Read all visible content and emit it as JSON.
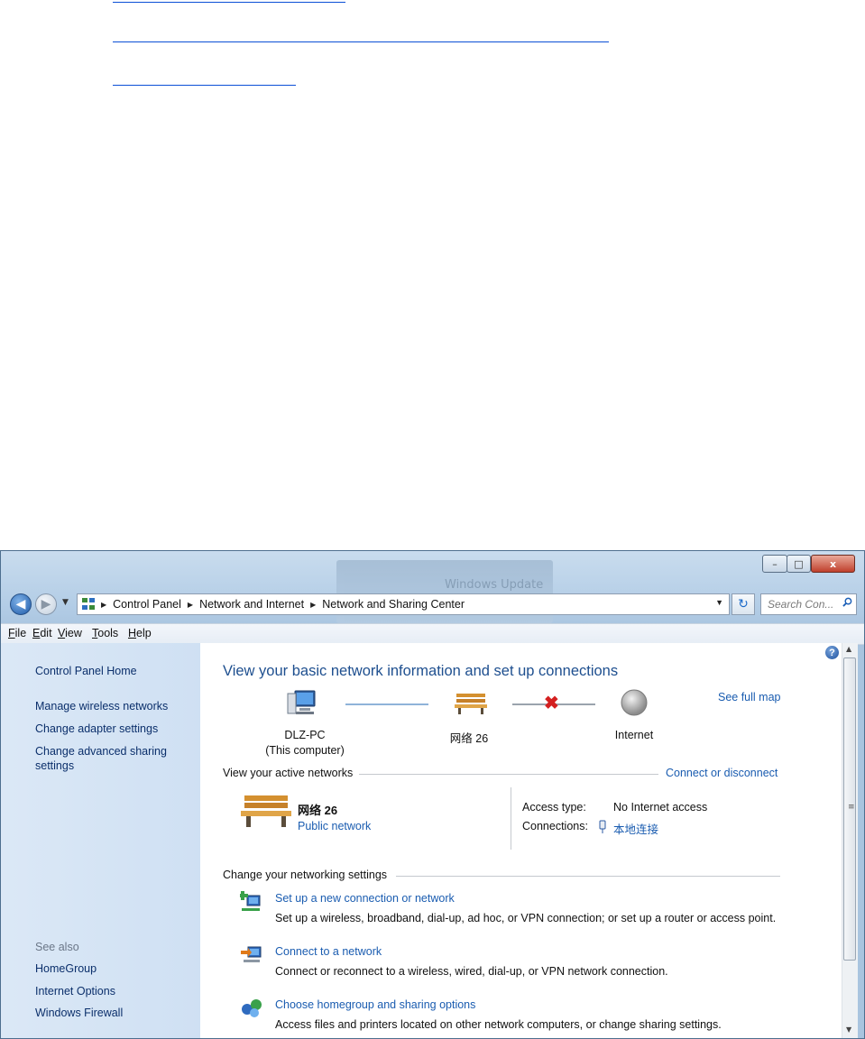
{
  "window": {
    "caption_minimize": "–",
    "caption_maximize": "□",
    "caption_close": "x",
    "background_ghost_text": "Windows Update"
  },
  "address": {
    "crumbs": [
      "Control Panel",
      "Network and Internet",
      "Network and Sharing Center"
    ],
    "search_placeholder": "Search Con..."
  },
  "menu": [
    "File",
    "Edit",
    "View",
    "Tools",
    "Help"
  ],
  "menu_underline": [
    "F",
    "E",
    "V",
    "T",
    "H"
  ],
  "sidebar": {
    "home": "Control Panel Home",
    "links": [
      "Manage wireless networks",
      "Change adapter settings",
      "Change advanced sharing",
      "settings"
    ],
    "see_also_label": "See also",
    "see_also": [
      "HomeGroup",
      "Internet Options",
      "Windows Firewall"
    ]
  },
  "main": {
    "heading": "View your basic network information and set up connections",
    "see_full_map": "See full map",
    "map": {
      "computer_name": "DLZ-PC",
      "computer_sub": "(This computer)",
      "network_name": "网络 26",
      "internet": "Internet"
    },
    "active_networks_label": "View your active networks",
    "connect_disconnect": "Connect or disconnect",
    "active": {
      "name": "网络 26",
      "type": "Public network",
      "access_type_label": "Access type:",
      "access_type_value": "No Internet access",
      "connections_label": "Connections:",
      "connections_value": "本地连接"
    },
    "change_settings_label": "Change your networking settings",
    "tasks": [
      {
        "title": "Set up a new connection or network",
        "desc": "Set up a wireless, broadband, dial-up, ad hoc, or VPN connection; or set up a router or access point."
      },
      {
        "title": "Connect to a network",
        "desc": "Connect or reconnect to a wireless, wired, dial-up, or VPN network connection."
      },
      {
        "title": "Choose homegroup and sharing options",
        "desc": "Access files and printers located on other network computers, or change sharing settings."
      }
    ]
  },
  "colors": {
    "link": "#1a5cb0",
    "heading": "#1e4f8f",
    "sidebar_bg": "#d6e5f5",
    "error_x": "#d42020"
  }
}
